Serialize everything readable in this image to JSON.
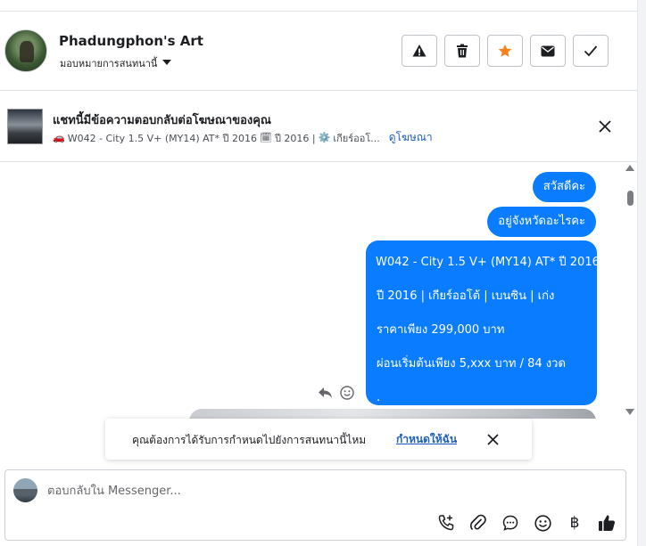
{
  "header": {
    "name": "Phadungphon's Art",
    "assign_label": "มอบหมายการสนทนานี้",
    "actions": [
      {
        "label": "Mark as spam",
        "icon": "warning-icon"
      },
      {
        "label": "Delete",
        "icon": "trash-icon"
      },
      {
        "label": "Star",
        "icon": "star-icon",
        "color": "#f5821f"
      },
      {
        "label": "Mark unread",
        "icon": "envelope-icon"
      },
      {
        "label": "Mark done",
        "icon": "check-icon"
      }
    ]
  },
  "ad_banner": {
    "title": "แชทนี้มีข้อความตอบกลับต่อโฆษณาของคุณ",
    "car_emoji": "🚗",
    "subtitle_part1": "W042 - City 1.5 V+ (MY14) AT* ปี 2016",
    "calendar_emoji": "🗓",
    "subtitle_part2": "ปี 2016 |",
    "gear_emoji": "⚙️",
    "subtitle_part3": "เกียร์ออโ...",
    "view_ad_link": "ดูโฆษณา"
  },
  "messages": {
    "m1": "สวัสดีคะ",
    "m2": "อยู่จังหวัดอะไรคะ",
    "m3": {
      "line1": "W042 - City 1.5 V+ (MY14) AT* ปี 2016",
      "line2": "ปี 2016 |  เกียร์ออโต้ |  เบนซิน |  เก่ง",
      "line3": "ราคาเพียง 299,000 บาท",
      "line4": "ผ่อนเริ่มต้นเพียง 5,xxx บาท / 84 งวด",
      "line5": "."
    }
  },
  "suggestion": {
    "text": "คุณต้องการได้รับการกำหนดไปยังการสนทนานี้ไหม",
    "link": "กำหนดให้ฉัน"
  },
  "composer": {
    "placeholder": "ตอบกลับใน Messenger...",
    "value": "",
    "baht_symbol": "฿"
  },
  "colors": {
    "accent": "#0a7cff",
    "link": "#1d5fbd",
    "star": "#f5821f"
  }
}
